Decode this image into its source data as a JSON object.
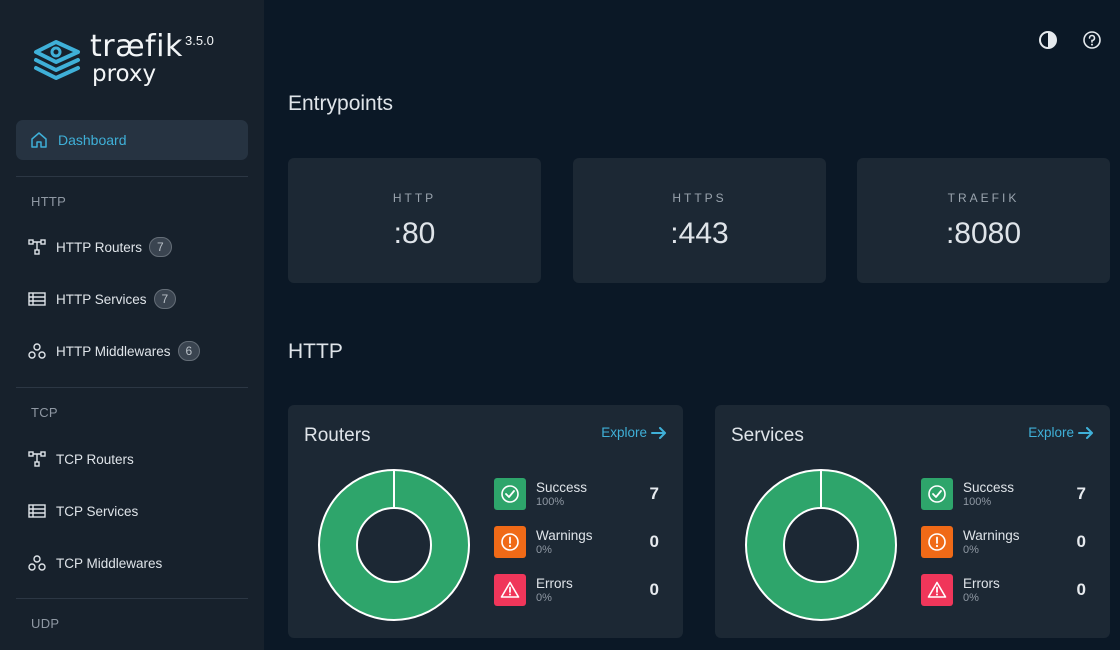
{
  "app": {
    "logo_word": "træfik",
    "logo_sub": "proxy",
    "version": "3.5.0"
  },
  "sidebar": {
    "dashboard": "Dashboard",
    "sections": [
      {
        "label": "HTTP",
        "items": [
          {
            "label": "HTTP Routers",
            "count": "7",
            "icon": "routers-icon"
          },
          {
            "label": "HTTP Services",
            "count": "7",
            "icon": "services-icon"
          },
          {
            "label": "HTTP Middlewares",
            "count": "6",
            "icon": "middlewares-icon"
          }
        ]
      },
      {
        "label": "TCP",
        "items": [
          {
            "label": "TCP Routers",
            "icon": "routers-icon"
          },
          {
            "label": "TCP Services",
            "icon": "services-icon"
          },
          {
            "label": "TCP Middlewares",
            "icon": "middlewares-icon"
          }
        ]
      },
      {
        "label": "UDP"
      }
    ]
  },
  "header": {
    "theme_icon": "contrast-icon",
    "help_icon": "help-icon"
  },
  "entrypoints": {
    "title": "Entrypoints",
    "items": [
      {
        "name": "HTTP",
        "port": ":80"
      },
      {
        "name": "HTTPS",
        "port": ":443"
      },
      {
        "name": "TRAEFIK",
        "port": ":8080"
      }
    ]
  },
  "http": {
    "title": "HTTP",
    "cards": [
      {
        "title": "Routers",
        "explore": "Explore",
        "stats": [
          {
            "name": "Success",
            "pct": "100%",
            "value": "7"
          },
          {
            "name": "Warnings",
            "pct": "0%",
            "value": "0"
          },
          {
            "name": "Errors",
            "pct": "0%",
            "value": "0"
          }
        ]
      },
      {
        "title": "Services",
        "explore": "Explore",
        "stats": [
          {
            "name": "Success",
            "pct": "100%",
            "value": "7"
          },
          {
            "name": "Warnings",
            "pct": "0%",
            "value": "0"
          },
          {
            "name": "Errors",
            "pct": "0%",
            "value": "0"
          }
        ]
      }
    ]
  },
  "colors": {
    "accent": "#3fb0d8",
    "success": "#2ea56b",
    "warning": "#f06a17",
    "error": "#f0365a",
    "sidebar": "#17212c",
    "card": "#1c2834",
    "background": "#0b1826"
  }
}
